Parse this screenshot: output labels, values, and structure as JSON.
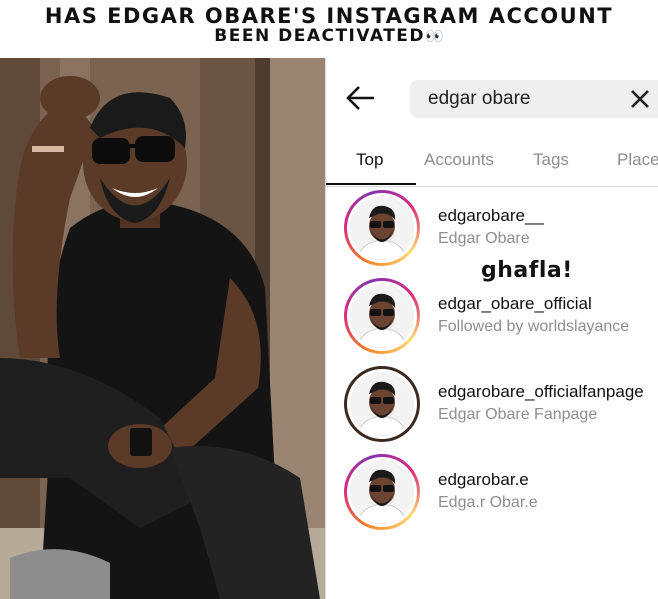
{
  "headline": {
    "line1": "Has Edgar Obare's Instagram account",
    "line2": "been deactivated",
    "eyes": "👀"
  },
  "search": {
    "query": "edgar obare"
  },
  "tabs": [
    {
      "label": "Top",
      "active": true
    },
    {
      "label": "Accounts",
      "active": false
    },
    {
      "label": "Tags",
      "active": false
    },
    {
      "label": "Places",
      "active": false
    }
  ],
  "results": [
    {
      "username": "edgarobare__",
      "subtitle": "Edgar Obare",
      "ring": "gradient"
    },
    {
      "username": "edgar_obare_official",
      "subtitle": "Followed by worldslayance",
      "ring": "gradient"
    },
    {
      "username": "edgarobare_officialfanpage",
      "subtitle": "Edgar Obare Fanpage",
      "ring": "dark"
    },
    {
      "username": "edgarobar.e",
      "subtitle": "Edga.r Obar.e",
      "ring": "gradient"
    }
  ],
  "watermark": "ghafla!",
  "colors": {
    "text_primary": "#111111",
    "text_secondary": "#8e8e8e",
    "search_bg": "#efefef",
    "divider": "#dbdbdb"
  },
  "icons": {
    "back": "arrow-left-icon",
    "clear": "close-icon"
  }
}
